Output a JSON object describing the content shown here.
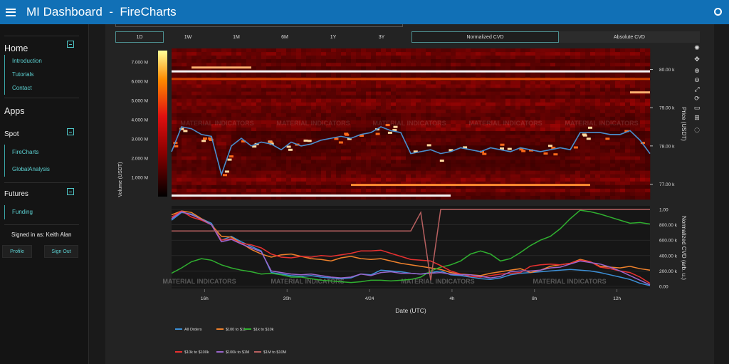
{
  "app": {
    "title": "MI Dashboard  -  FireCharts"
  },
  "sidebar": {
    "home": {
      "title": "Home",
      "items": [
        "Introduction",
        "Tutorials",
        "Contact"
      ]
    },
    "apps_title": "Apps",
    "spot": {
      "title": "Spot",
      "items": [
        "FireCharts",
        "GlobalAnalysis"
      ]
    },
    "futures": {
      "title": "Futures",
      "items": [
        "Funding"
      ]
    },
    "signed_in": "Signed in as: Keith Alan",
    "profile_label": "Profile",
    "signout_label": "Sign Out"
  },
  "timeframes": {
    "items": [
      "1D",
      "1W",
      "1M",
      "6M",
      "1Y",
      "3Y"
    ],
    "active": "1D"
  },
  "cvd_toggle": {
    "normalized": "Normalized CVD",
    "absolute": "Absolute CVD",
    "active": "normalized"
  },
  "toolbar_icons": [
    "plotly-logo-icon",
    "pan-icon",
    "zoom-in-icon",
    "zoom-out-icon",
    "autoscale-icon",
    "reset-axes-icon",
    "download-icon",
    "spike-lines-icon",
    "hover-compare-icon"
  ],
  "watermark": "MATERIAL INDICATORS",
  "colors": {
    "heatmap_low": "#000000",
    "heatmap_mid": "#cc0000",
    "heatmap_high": "#ffff66",
    "price_line": "#4a8fcf",
    "accent": "#4fc6c7",
    "header": "#1170b6"
  },
  "chart_data": [
    {
      "type": "heatmap",
      "xlabel": "Date (UTC)",
      "ylabel": "Price (USDT)",
      "ylim": [
        76600,
        80550
      ],
      "y_ticks": [
        {
          "v": 77000,
          "label": "77.00 k"
        },
        {
          "v": 78000,
          "label": "78.00 k"
        },
        {
          "v": 79000,
          "label": "79.00 k"
        },
        {
          "v": 80000,
          "label": "80.00 k"
        }
      ],
      "colorbar": {
        "label": "Volume (USDT)",
        "range": [
          0,
          7600000
        ],
        "ticks": [
          {
            "v": 1000000,
            "label": "1.000 M"
          },
          {
            "v": 2000000,
            "label": "2.000 M"
          },
          {
            "v": 3000000,
            "label": "3.000 M"
          },
          {
            "v": 4000000,
            "label": "4.000 M"
          },
          {
            "v": 5000000,
            "label": "5.000 M"
          },
          {
            "v": 6000000,
            "label": "6.000 M"
          },
          {
            "v": 7000000,
            "label": "7.000 M"
          }
        ]
      },
      "x_ticks": [
        "16h",
        "20h",
        "4/24",
        "4h",
        "8h",
        "12h"
      ],
      "price_series": {
        "x": [
          0,
          0.5,
          1,
          1.5,
          2,
          2.5,
          3,
          3.5,
          4,
          4.5,
          5,
          5.5,
          6,
          6.5,
          7,
          7.5,
          8,
          8.5,
          9,
          9.5,
          10,
          10.5,
          11,
          11.5,
          12,
          12.5,
          13,
          13.5,
          14,
          14.5,
          15,
          15.5,
          16,
          16.5,
          17,
          17.5,
          18,
          18.5,
          19,
          19.5,
          20,
          20.5,
          21,
          21.5,
          22,
          22.5,
          23,
          23.5,
          24
        ],
        "y": [
          77850,
          78500,
          78450,
          78300,
          78250,
          77250,
          78000,
          78200,
          78000,
          78100,
          78050,
          77900,
          78100,
          78000,
          78050,
          78150,
          78200,
          78250,
          78200,
          78300,
          78350,
          78500,
          78400,
          78350,
          77800,
          77850,
          77900,
          77800,
          77850,
          77950,
          77900,
          77850,
          77950,
          77900,
          77850,
          77950,
          77900,
          77850,
          77900,
          77950,
          77900,
          78350,
          78350,
          78350,
          78300,
          78300,
          78400,
          78150,
          77800
        ]
      },
      "liquidity_bands": [
        {
          "price": 79950,
          "from": 0,
          "to": 24,
          "volume": 7400000
        },
        {
          "price": 80050,
          "from": 1,
          "to": 4,
          "volume": 6000000
        },
        {
          "price": 79750,
          "from": 0,
          "to": 24,
          "volume": 3000000
        },
        {
          "price": 79400,
          "from": 23,
          "to": 24,
          "volume": 5500000
        },
        {
          "price": 76980,
          "from": 9,
          "to": 21,
          "volume": 4500000
        },
        {
          "price": 76700,
          "from": 0,
          "to": 14,
          "volume": 7200000
        }
      ]
    },
    {
      "type": "line",
      "ylabel": "Normalized CVD (arb. u.)",
      "ylim": [
        0,
        1000
      ],
      "y_ticks": [
        {
          "v": 0,
          "label": "0.00"
        },
        {
          "v": 200,
          "label": "200.00 k"
        },
        {
          "v": 400,
          "label": "400.00 k"
        },
        {
          "v": 600,
          "label": "600.00 k"
        },
        {
          "v": 800,
          "label": "800.00 k"
        },
        {
          "v": 1000,
          "label": "1.00"
        }
      ],
      "x": [
        0,
        0.5,
        1,
        1.5,
        2,
        2.5,
        3,
        3.5,
        4,
        4.5,
        5,
        5.5,
        6,
        6.5,
        7,
        7.5,
        8,
        8.5,
        9,
        9.5,
        10,
        10.5,
        11,
        11.5,
        12,
        12.5,
        13,
        13.5,
        14,
        14.5,
        15,
        15.5,
        16,
        16.5,
        17,
        17.5,
        18,
        18.5,
        19,
        19.5,
        20,
        20.5,
        21,
        21.5,
        22,
        22.5,
        23,
        23.5,
        24
      ],
      "series": [
        {
          "name": "All Orders",
          "color": "#3c8fd6",
          "values": [
            860,
            960,
            940,
            880,
            820,
            600,
            650,
            580,
            520,
            460,
            180,
            160,
            140,
            130,
            140,
            120,
            110,
            100,
            110,
            160,
            150,
            210,
            200,
            190,
            170,
            160,
            180,
            200,
            150,
            140,
            120,
            100,
            90,
            110,
            150,
            170,
            180,
            190,
            200,
            210,
            220,
            210,
            200,
            180,
            150,
            120,
            90,
            40,
            10
          ]
        },
        {
          "name": "$100 to $1k",
          "color": "#f0822c",
          "values": [
            930,
            980,
            960,
            880,
            800,
            650,
            640,
            560,
            480,
            420,
            380,
            410,
            420,
            390,
            360,
            350,
            330,
            370,
            390,
            360,
            350,
            360,
            330,
            300,
            280,
            260,
            240,
            220,
            180,
            160,
            150,
            140,
            170,
            190,
            210,
            230,
            180,
            210,
            260,
            280,
            300,
            350,
            320,
            260,
            250,
            240,
            260,
            230,
            210
          ]
        },
        {
          "name": "$1k to $10k",
          "color": "#30b030",
          "values": [
            170,
            240,
            320,
            360,
            340,
            280,
            240,
            210,
            190,
            160,
            170,
            150,
            120,
            120,
            100,
            80,
            70,
            60,
            50,
            60,
            80,
            80,
            70,
            80,
            90,
            120,
            200,
            250,
            280,
            330,
            420,
            460,
            420,
            330,
            360,
            440,
            530,
            600,
            650,
            750,
            880,
            990,
            970,
            940,
            900,
            860,
            820,
            830,
            810
          ]
        },
        {
          "name": "$10k to $100k",
          "color": "#e83030",
          "values": [
            900,
            980,
            900,
            860,
            800,
            600,
            620,
            560,
            540,
            500,
            420,
            380,
            370,
            390,
            380,
            400,
            390,
            410,
            430,
            460,
            460,
            470,
            430,
            390,
            350,
            340,
            330,
            270,
            200,
            160,
            130,
            120,
            140,
            160,
            170,
            180,
            260,
            280,
            290,
            280,
            300,
            340,
            320,
            250,
            230,
            200,
            180,
            120,
            40
          ]
        },
        {
          "name": "$100k to $1M",
          "color": "#9a66cc",
          "values": [
            880,
            970,
            930,
            870,
            800,
            580,
            610,
            550,
            500,
            450,
            200,
            180,
            160,
            150,
            160,
            140,
            120,
            110,
            120,
            160,
            140,
            180,
            190,
            170,
            170,
            160,
            170,
            180,
            160,
            150,
            150,
            130,
            110,
            130,
            190,
            200,
            200,
            210,
            240,
            250,
            290,
            330,
            310,
            290,
            250,
            200,
            140,
            80,
            20
          ]
        },
        {
          "name": "$1M to $10M",
          "color": "#b86060",
          "values": [
            720,
            720,
            720,
            720,
            720,
            720,
            720,
            720,
            720,
            720,
            720,
            720,
            720,
            720,
            720,
            720,
            720,
            720,
            720,
            720,
            720,
            720,
            720,
            720,
            720,
            960,
            80,
            1000,
            1000,
            1000,
            1000,
            1000,
            1000,
            1000,
            1000,
            1000,
            1000,
            1000,
            1000,
            1000,
            1000,
            1000,
            1000,
            1000,
            1000,
            1000,
            1000,
            1000,
            1000
          ]
        }
      ]
    }
  ]
}
